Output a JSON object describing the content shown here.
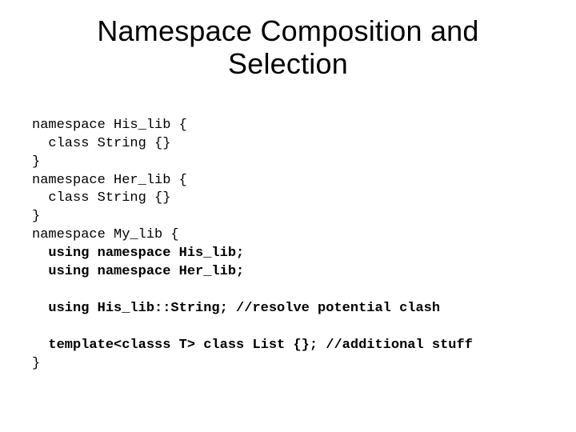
{
  "title": "Namespace Composition and Selection",
  "code": {
    "l1": "namespace His_lib {",
    "l2": "  class String {}",
    "l3": "}",
    "l4": "namespace Her_lib {",
    "l5": "  class String {}",
    "l6": "}",
    "l7": "namespace My_lib {",
    "l8a": "  using namespace His_lib;",
    "l8b": "  using namespace Her_lib;",
    "blank1": "",
    "l9": "  using His_lib::String; //resolve potential clash",
    "blank2": "",
    "l10": "  template<classs T> class List {}; //additional stuff",
    "l11": "}"
  }
}
